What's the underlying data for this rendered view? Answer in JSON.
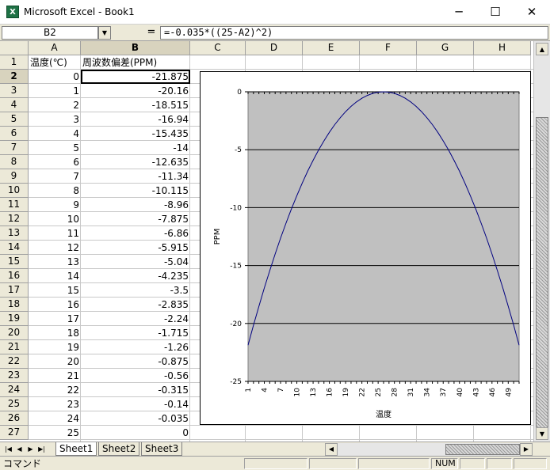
{
  "window": {
    "title": "Microsoft Excel - Book1",
    "minimize_glyph": "─",
    "maximize_glyph": "☐",
    "close_glyph": "✕"
  },
  "formula_bar": {
    "name_box": "B2",
    "equals": "=",
    "formula": "=-0.035*((25-A2)^2)"
  },
  "columns": [
    "A",
    "B",
    "C",
    "D",
    "E",
    "F",
    "G",
    "H"
  ],
  "active_column": "B",
  "active_row": "2",
  "rows": [
    "1",
    "2",
    "3",
    "4",
    "5",
    "6",
    "7",
    "8",
    "9",
    "10",
    "11",
    "12",
    "13",
    "14",
    "15",
    "16",
    "17",
    "18",
    "19",
    "20",
    "21",
    "22",
    "23",
    "24",
    "25",
    "26",
    "27"
  ],
  "sheet": {
    "header_a": "温度(℃)",
    "header_b": "周波数偏差(PPM)",
    "temperature": [
      "0",
      "1",
      "2",
      "3",
      "4",
      "5",
      "6",
      "7",
      "8",
      "9",
      "10",
      "11",
      "12",
      "13",
      "14",
      "15",
      "16",
      "17",
      "18",
      "19",
      "20",
      "21",
      "22",
      "23",
      "24",
      "25"
    ],
    "deviation": [
      "-21.875",
      "-20.16",
      "-18.515",
      "-16.94",
      "-15.435",
      "-14",
      "-12.635",
      "-11.34",
      "-10.115",
      "-8.96",
      "-7.875",
      "-6.86",
      "-5.915",
      "-5.04",
      "-4.235",
      "-3.5",
      "-2.835",
      "-2.24",
      "-1.715",
      "-1.26",
      "-0.875",
      "-0.56",
      "-0.315",
      "-0.14",
      "-0.035",
      "0"
    ]
  },
  "chart_data": {
    "type": "line",
    "x": [
      1,
      2,
      3,
      4,
      5,
      6,
      7,
      8,
      9,
      10,
      11,
      12,
      13,
      14,
      15,
      16,
      17,
      18,
      19,
      20,
      21,
      22,
      23,
      24,
      25,
      26,
      27,
      28,
      29,
      30,
      31,
      32,
      33,
      34,
      35,
      36,
      37,
      38,
      39,
      40,
      41,
      42,
      43,
      44,
      45,
      46,
      47,
      48,
      49,
      50,
      51
    ],
    "series": [
      {
        "values": [
          -21.875,
          -20.16,
          -18.515,
          -16.94,
          -15.435,
          -14,
          -12.635,
          -11.34,
          -10.115,
          -8.96,
          -7.875,
          -6.86,
          -5.915,
          -5.04,
          -4.235,
          -3.5,
          -2.835,
          -2.24,
          -1.715,
          -1.26,
          -0.875,
          -0.56,
          -0.315,
          -0.14,
          -0.035,
          0,
          -0.035,
          -0.14,
          -0.315,
          -0.56,
          -0.875,
          -1.26,
          -1.715,
          -2.24,
          -2.835,
          -3.5,
          -4.235,
          -5.04,
          -5.915,
          -6.86,
          -7.875,
          -8.96,
          -10.115,
          -11.34,
          -12.635,
          -14,
          -15.435,
          -16.94,
          -18.515,
          -20.16,
          -21.875
        ]
      }
    ],
    "x_tick_labels": [
      "1",
      "4",
      "7",
      "10",
      "13",
      "16",
      "19",
      "22",
      "25",
      "28",
      "31",
      "34",
      "37",
      "40",
      "43",
      "46",
      "49"
    ],
    "y_tick_labels": [
      "0",
      "-5",
      "-10",
      "-15",
      "-20",
      "-25"
    ],
    "xlabel": "温度",
    "ylabel": "PPM",
    "ylim": [
      -25,
      0
    ],
    "grid": true,
    "plot_background": "#c0c0c0",
    "line_color": "#000080"
  },
  "sheet_tabs": [
    "Sheet1",
    "Sheet2",
    "Sheet3"
  ],
  "active_tab": "Sheet1",
  "status": {
    "mode": "コマンド",
    "num": "NUM"
  },
  "colors": {
    "chrome": "#ece9d8",
    "grid_line": "#c8c8c8",
    "excel_green": "#1e7145"
  }
}
